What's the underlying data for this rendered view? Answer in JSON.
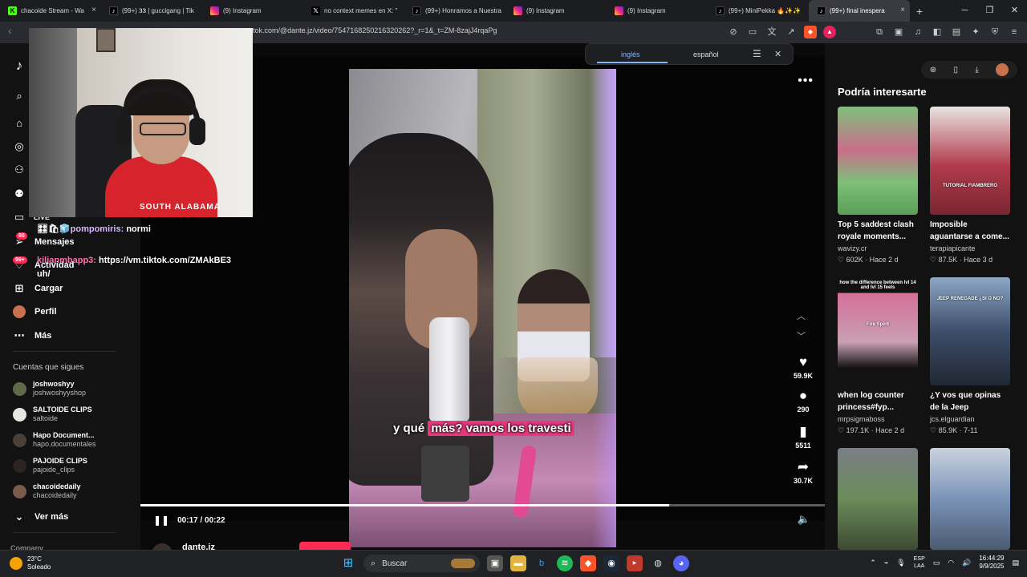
{
  "browser": {
    "tabs": [
      {
        "title": "chacoide Stream - Wa",
        "icon": "kick-icon"
      },
      {
        "title": "(99+) 𝟑𝟑 | guccigang | Tik",
        "icon": "tiktok-icon"
      },
      {
        "title": "(9) Instagram",
        "icon": "instagram-icon"
      },
      {
        "title": "no context memes en X: \"",
        "icon": "x-icon"
      },
      {
        "title": "(99+) Honramos a Nuestra",
        "icon": "tiktok-icon"
      },
      {
        "title": "(9) Instagram",
        "icon": "instagram-icon"
      },
      {
        "title": "(9) Instagram",
        "icon": "instagram-icon"
      },
      {
        "title": "(99+) MiniPekka 🔥✨✨",
        "icon": "tiktok-icon"
      },
      {
        "title": "(99+) final inespera",
        "icon": "tiktok-icon",
        "active": true
      }
    ],
    "url": "tok.com/@dante.jz/video/7547168250216320262?_r=1&_t=ZM-8zajJ4rqaPg"
  },
  "translate": {
    "from": "inglés",
    "to": "español"
  },
  "sidebar": {
    "items": [
      {
        "label": "LIVE"
      },
      {
        "label": "Mensajes",
        "badge": "80"
      },
      {
        "label": "Actividad",
        "badge": "99+"
      },
      {
        "label": "Cargar"
      },
      {
        "label": "Perfil"
      },
      {
        "label": "Más"
      }
    ],
    "following_title": "Cuentas que sigues",
    "following": [
      {
        "name": "joshwoshyy",
        "handle": "joshwoshyyshop"
      },
      {
        "name": "SALTOIDE CLIPS",
        "handle": "saltoide"
      },
      {
        "name": "Hapo Document...",
        "handle": "hapo.documentales"
      },
      {
        "name": "PAJOIDE CLIPS",
        "handle": "pajoide_clips"
      },
      {
        "name": "chacoidedaily",
        "handle": "chacoidedaily"
      }
    ],
    "see_more": "Ver más",
    "company": "Company"
  },
  "chat": {
    "lines": [
      {
        "user": "pompomiris:",
        "msg": "normi",
        "prefix": "🎛🛍🧊"
      },
      {
        "user": "kilianmbapp3:",
        "msg": "https://vm.tiktok.com/ZMAkBE3"
      }
    ],
    "overflow": "uh/"
  },
  "video": {
    "caption_plain": "y qué",
    "caption_highlight": "más? vamos los travesti",
    "time": "00:17 / 00:22",
    "progress": 0.7727,
    "author": "dante.jz"
  },
  "actions": {
    "likes": "59.9K",
    "comments": "290",
    "saves": "5511",
    "shares": "30.7K"
  },
  "right": {
    "title": "Podría interesarte",
    "recs": [
      {
        "title": "Top 5 saddest clash royale moments...",
        "author": "wavizy.cr",
        "likes": "602K",
        "age": "Hace 2 d",
        "bg": "#7fbf7a"
      },
      {
        "title": "Imposible aguantarse a come...",
        "author": "terapiapicante",
        "likes": "87.5K",
        "age": "Hace 3 d",
        "bg": "#b13a4a",
        "label": "TUTORIAL FIAMBRERO"
      },
      {
        "title": "when log counter princess#fyp...",
        "author": "mrpsigmaboss",
        "likes": "197.1K",
        "age": "Hace 2 d",
        "bg": "#d4709a",
        "overlay": "how the difference between lvl 14 and lvl 15 feels",
        "label": "Fire Spirit"
      },
      {
        "title": "¿Y vos que opinas de la Jeep Renegade?...",
        "author": "jcs.elguardian",
        "likes": "85.9K",
        "age": "7-11",
        "bg": "#3d4d6a",
        "label": "JEEP RENEGADE ¿SI O NO?"
      },
      {
        "title": "",
        "author": "",
        "likes": "",
        "age": "",
        "bg": "#6a8c5a"
      },
      {
        "title": "",
        "author": "",
        "likes": "",
        "age": "",
        "bg": "#7a93b8"
      }
    ]
  },
  "taskbar": {
    "temp": "23°C",
    "weather": "Soleado",
    "search": "Buscar",
    "lang1": "ESP",
    "lang2": "LAA",
    "time": "16:44:29",
    "date": "9/9/2025"
  },
  "webcam": {
    "shirt_text": "SOUTH ALABAMA"
  },
  "colors": {
    "accent": "#fe2c55",
    "bg": "#121212"
  }
}
